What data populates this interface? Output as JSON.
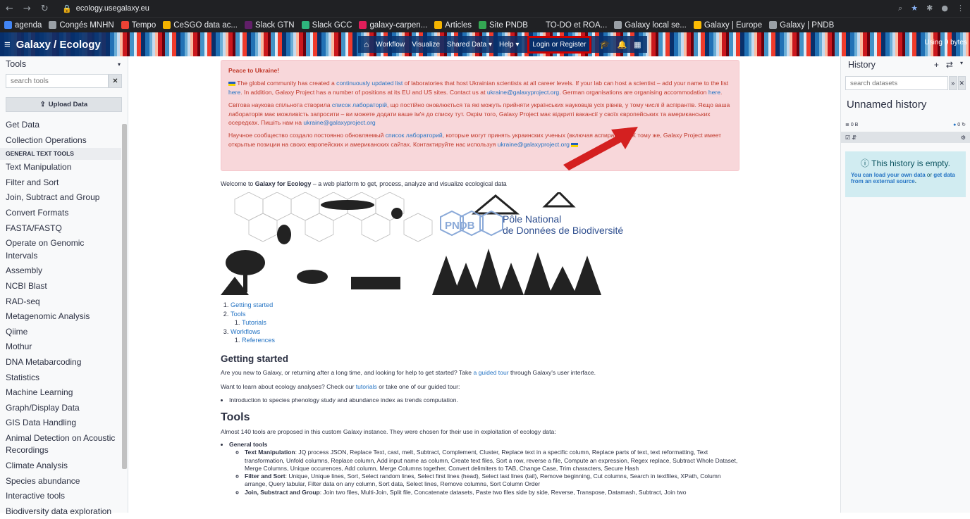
{
  "browser": {
    "url": "ecology.usegalaxy.eu",
    "bookmarks": [
      "agenda",
      "Congés MNHN",
      "Tempo",
      "CeSGO data ac...",
      "Slack GTN",
      "Slack GCC",
      "galaxy-carpen...",
      "Articles",
      "Site PNDB",
      "TO-DO et ROA...",
      "Galaxy local se...",
      "Galaxy | Europe",
      "Galaxy | PNDB"
    ]
  },
  "masthead": {
    "brand": "Galaxy / Ecology",
    "menu": [
      "Workflow",
      "Visualize",
      "Shared Data ▾",
      "Help ▾"
    ],
    "login": "Login or Register",
    "usage": "Using 0 bytes"
  },
  "tools": {
    "title": "Tools",
    "search_placeholder": "search tools",
    "upload": "Upload Data",
    "items": [
      {
        "label": "Get Data",
        "section": false
      },
      {
        "label": "Collection Operations",
        "section": false
      },
      {
        "label": "GENERAL TEXT TOOLS",
        "section": true
      },
      {
        "label": "Text Manipulation",
        "section": false
      },
      {
        "label": "Filter and Sort",
        "section": false
      },
      {
        "label": "Join, Subtract and Group",
        "section": false
      },
      {
        "label": "Convert Formats",
        "section": false
      },
      {
        "label": "FASTA/FASTQ",
        "section": false
      },
      {
        "label": "Operate on Genomic Intervals",
        "section": false
      },
      {
        "label": "Assembly",
        "section": false
      },
      {
        "label": "NCBI Blast",
        "section": false
      },
      {
        "label": "RAD-seq",
        "section": false
      },
      {
        "label": "Metagenomic Analysis",
        "section": false
      },
      {
        "label": "Qiime",
        "section": false
      },
      {
        "label": "Mothur",
        "section": false
      },
      {
        "label": "DNA Metabarcoding",
        "section": false
      },
      {
        "label": "Statistics",
        "section": false
      },
      {
        "label": "Machine Learning",
        "section": false
      },
      {
        "label": "Graph/Display Data",
        "section": false
      },
      {
        "label": "GIS Data Handling",
        "section": false
      },
      {
        "label": "Animal Detection on Acoustic Recordings",
        "section": false
      },
      {
        "label": "Climate Analysis",
        "section": false
      },
      {
        "label": "Species abundance",
        "section": false
      },
      {
        "label": "Interactive tools",
        "section": false
      },
      {
        "label": "Biodiversity data exploration",
        "section": false
      }
    ]
  },
  "alert": {
    "title": "Peace to Ukraine!",
    "en_1": " The global community has created a ",
    "en_link1": "continuously updated list",
    "en_2": " of laboratories that host Ukrainian scientists at all career levels. If your lab can host a scientist – add your name to the list ",
    "en_link2": "here",
    "en_3": ". In addition, Galaxy Project has a number of positions at its EU and US sites. Contact us at ",
    "en_link3": "ukraine@galaxyproject.org",
    "en_4": ". German organisations are organising accommodation ",
    "en_link4": "here",
    "en_5": ".",
    "uk_1": "Світова наукова спільнота створила ",
    "uk_link1": "список лабораторій",
    "uk_2": ", що постійно оновлюється та які можуть прийняти українських науковців усіх рівнів, у тому числі й аспірантів. Якщо ваша лабораторія має можливість запросити – ви можете додати ваше ім'я до списку тут. Окрім того, Galaxy Project має відкриті вакансії у своїх європейських та американських осередках. Пишіть нам на ",
    "uk_link2": "ukraine@galaxyproject.org",
    "ru_1": "Научное сообщество создало постоянно обновляемый ",
    "ru_link1": "список лабораторий",
    "ru_2": ", которые могут принять украинских ученых (включая аспирантов). К тому же, Galaxy Project имеет открытые позиции на своих европейских и американских сайтах. Контактируйте нас используя ",
    "ru_link2": "ukraine@galaxyproject.org"
  },
  "welcome": {
    "pre": "Welcome to ",
    "bold": "Galaxy for Ecology",
    "post": " – a web platform to get, process, analyze and visualize ecological data"
  },
  "banner": {
    "logo": "PNDB",
    "line1": "Pôle National",
    "line2": "de Données de Biodiversité"
  },
  "toc": [
    "Getting started",
    "Tools",
    "Tutorials",
    "Workflows",
    "References"
  ],
  "getting_started": {
    "heading": "Getting started",
    "p1_pre": "Are you new to Galaxy, or returning after a long time, and looking for help to get started? Take ",
    "p1_link": "a guided tour",
    "p1_post": " through Galaxy's user interface.",
    "p2_pre": "Want to learn about ecology analyses? Check our ",
    "p2_link": "tutorials",
    "p2_post": " or take one of our guided tour:",
    "bullet": "Introduction to species phenology study and abundance index as trends computation."
  },
  "tools_section": {
    "heading": "Tools",
    "intro": "Almost 140 tools are proposed in this custom Galaxy instance. They were chosen for their use in exploitation of ecology data:",
    "general": "General tools",
    "tm_label": "Text Manipulation",
    "tm_text": ": JQ process JSON, Replace Text, cast, melt, Subtract, Complement, Cluster, Replace text in a specific column, Replace parts of text, text reformatting, Text transformation, Unfold columns, Replace column, Add input name as column, Create text files, Sort a row, reverse a file, Compute an expression, Regex replace, Subtract Whole Dataset, Merge Columns, Unique occurences, Add column, Merge Columns together, Convert delimiters to TAB, Change Case, Trim characters, Secure Hash",
    "fs_label": "Filter and Sort",
    "fs_text": ": Unique, Unique lines, Sort, Select random lines, Select first lines (head), Select last lines (tail), Remove beginning, Cut columns, Search in textfiles, XPath, Column arrange, Query tabular, Filter data on any column, Sort data, Select lines, Remove columns, Sort Column Order",
    "js_label": "Join, Substract and Group",
    "js_text": ": Join two files, Multi-Join, Split file, Concatenate datasets, Paste two files side by side, Reverse, Transpose, Datamash, Subtract, Join two"
  },
  "history": {
    "title": "History",
    "search_placeholder": "search datasets",
    "name": "Unnamed history",
    "size": "0 B",
    "count": "0",
    "empty_title": "This history is empty.",
    "empty_link1": "You can load your own data",
    "empty_mid": " or ",
    "empty_link2": "get data from an external source",
    "empty_end": "."
  }
}
